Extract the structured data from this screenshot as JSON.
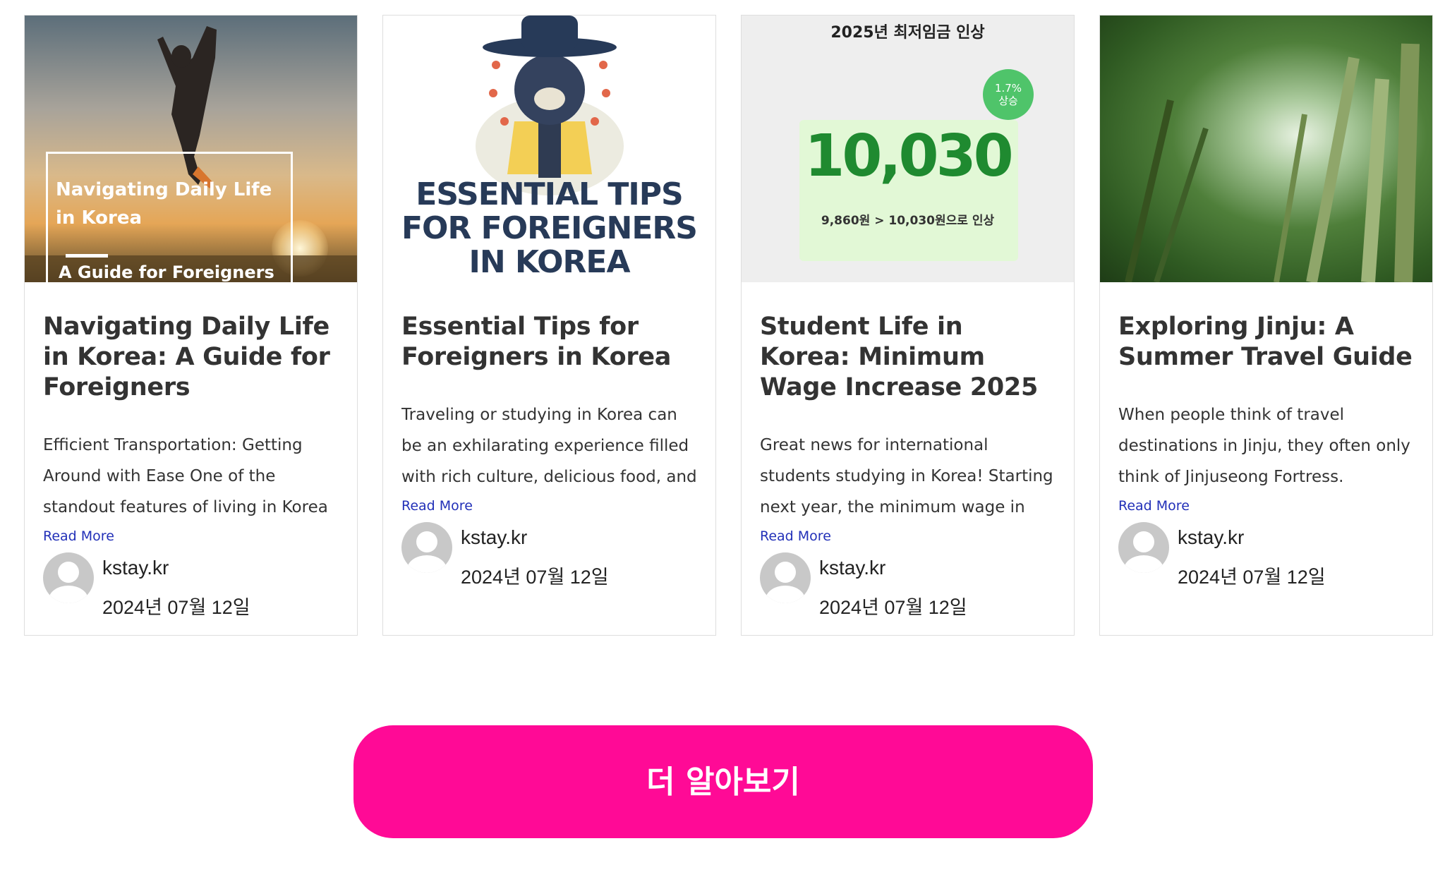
{
  "posts": [
    {
      "title": "Navigating Daily Life in Korea: A Guide for Foreigners",
      "excerpt": "Efficient Transportation: Getting Around with Ease One of the standout features of living in Korea",
      "read_more": "Read More",
      "author": "kstay.kr",
      "date": "2024년 07월 12일",
      "thumbnail": {
        "line1": "Navigating Daily Life",
        "line2": "in Korea",
        "line3": "A Guide for Foreigners"
      }
    },
    {
      "title": "Essential Tips for Foreigners in Korea",
      "excerpt": "Traveling or studying in Korea can be an exhilarating experience filled with rich culture, delicious food, and friendly people. However,...",
      "read_more": "Read More",
      "author": "kstay.kr",
      "date": "2024년 07월 12일",
      "thumbnail": {
        "line1": "ESSENTIAL TIPS",
        "line2": "FOR FOREIGNERS",
        "line3": "IN KOREA"
      }
    },
    {
      "title": "Student Life in Korea: Minimum Wage Increase 2025",
      "excerpt": "Great news for international students studying in Korea! Starting next year, the minimum wage in",
      "read_more": "Read More",
      "author": "kstay.kr",
      "date": "2024년 07월 12일",
      "thumbnail": {
        "heading": "2025년 최저임금 인상",
        "big_number": "10,030",
        "sub": "9,860원 > 10,030원으로 인상",
        "badge_line1": "1.7%",
        "badge_line2": "상승"
      }
    },
    {
      "title": "Exploring Jinju: A Summer Travel Guide",
      "excerpt": "When people think of travel destinations in Jinju, they often only think of Jinjuseong Fortress. However, Jinju offers many other...",
      "read_more": "Read More",
      "author": "kstay.kr",
      "date": "2024년 07월 12일"
    }
  ],
  "cta": {
    "label": "더 알아보기"
  },
  "colors": {
    "cta_background": "#ff0a96",
    "link": "#2230b8",
    "title_text": "#333333",
    "card_border": "#dedede"
  },
  "icons": {
    "avatar": "default-user-avatar-icon"
  }
}
